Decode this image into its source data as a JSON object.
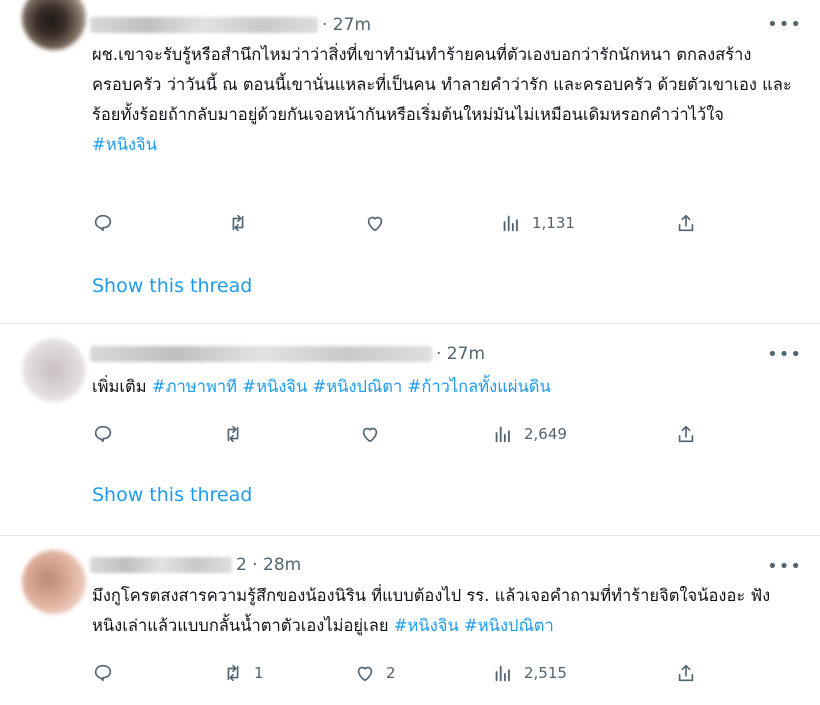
{
  "tweets": [
    {
      "time": "· 27m",
      "text": "ผช.เขาจะรับรู้หรือสำนึกไหมว่าว่าสิ่งที่เขาทำมันทำร้ายคนที่ตัวเองบอกว่ารักนักหนา ตกลงสร้างครอบครัว ว่าวันนี้ ณ ตอนนี้เขานั่นแหละที่เป็นคน ทำลายคำว่ารัก และครอบครัว ด้วยตัวเขาเอง และร้อยทั้งร้อยถ้ากลับมาอยู่ด้วยกันเจอหน้ากันหรือเริ่มต้นใหม่มันไม่เหมือนเดิมหรอกคำว่าไว้ใจ",
      "hashtags": "#หนิงจิน",
      "replies": "",
      "retweets": "",
      "likes": "",
      "views": "1,131",
      "show_thread": "Show this thread"
    },
    {
      "time": "· 27m",
      "text": "เพิ่มเติม",
      "hashtags": "#ภาษาพาที #หนิงจิน #หนิงปณิตา #ก้าวไกลทั้งแผ่นดิน",
      "replies": "",
      "retweets": "",
      "likes": "",
      "views": "2,649",
      "show_thread": "Show this thread"
    },
    {
      "time": "2 · 28m",
      "text": "มึงกูโครตสงสารความรู้สึกของน้องนิริน ที่แบบต้องไป รร. แล้วเจอคำถามที่ทำร้ายจิตใจน้องอะ ฟังหนิงเล่าแล้วแบบกลั้นน้ำตาตัวเองไม่อยู่เลย",
      "hashtags": "#หนิงจิน #หนิงปณิตา",
      "replies": "",
      "retweets": "1",
      "likes": "2",
      "views": "2,515"
    }
  ],
  "icons": [
    "reply-icon",
    "retweet-icon",
    "like-icon",
    "views-icon",
    "share-icon",
    "more-icon"
  ],
  "colors": {
    "link": "#1d9bf0",
    "muted": "#536471",
    "text": "#0f1419",
    "separator": "#e7e9ea"
  }
}
